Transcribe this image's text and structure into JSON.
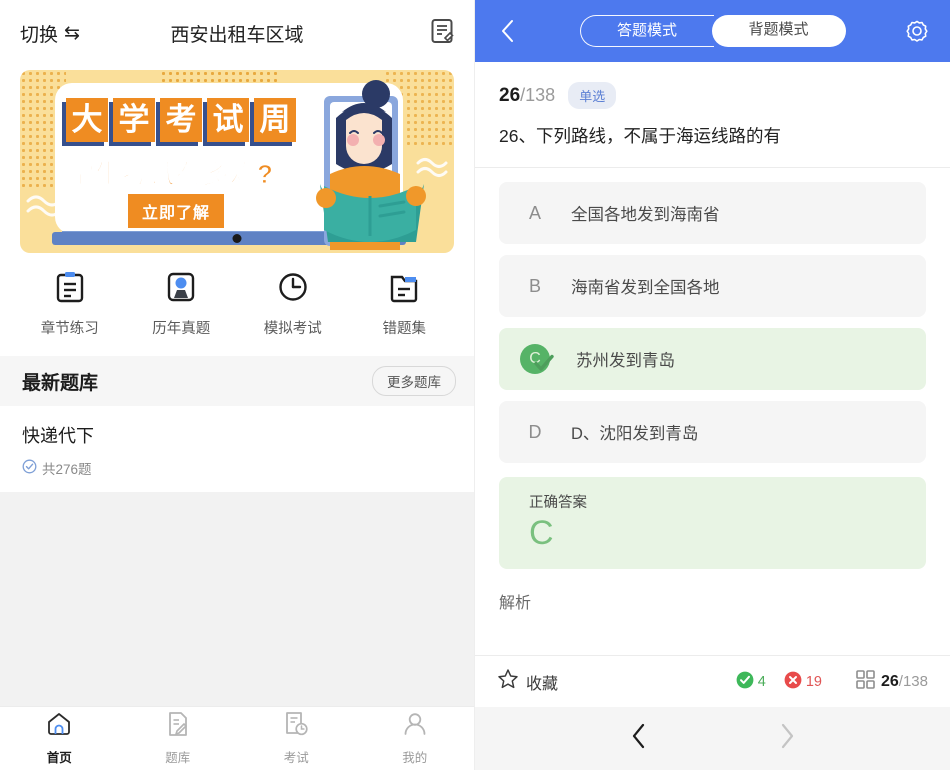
{
  "left": {
    "topbar": {
      "switch_label": "切换",
      "switch_icon": "swap-arrows-icon",
      "title": "西安出租车区域",
      "doc_icon": "note-document-icon"
    },
    "banner": {
      "title_chars": [
        "大",
        "学",
        "考",
        "试",
        "周"
      ],
      "subtitle": "学生考试有多难?",
      "cta_label": "立即了解"
    },
    "quick_actions": [
      {
        "label": "章节练习",
        "icon": "clipboard-icon"
      },
      {
        "label": "历年真题",
        "icon": "award-badge-icon"
      },
      {
        "label": "模拟考试",
        "icon": "clock-icon"
      },
      {
        "label": "错题集",
        "icon": "folder-document-icon"
      }
    ],
    "section": {
      "title": "最新题库",
      "more_label": "更多题库"
    },
    "bank_item": {
      "name": "快递代下",
      "meta": "共276题",
      "meta_icon": "check-circle-icon"
    },
    "tabbar": [
      {
        "label": "首页",
        "icon": "home-icon",
        "active": true
      },
      {
        "label": "题库",
        "icon": "question-bank-icon",
        "active": false
      },
      {
        "label": "考试",
        "icon": "exam-clock-icon",
        "active": false
      },
      {
        "label": "我的",
        "icon": "person-icon",
        "active": false
      }
    ]
  },
  "right": {
    "header": {
      "back_icon": "chevron-left-icon",
      "mode_answer": "答题模式",
      "mode_review": "背题模式",
      "gear_icon": "gear-icon",
      "accent_color": "#4d79ee"
    },
    "question": {
      "current": "26",
      "separator": "/",
      "total": "138",
      "type_badge": "单选",
      "text": "26、下列路线，不属于海运线路的有"
    },
    "options": [
      {
        "letter": "A",
        "text": "全国各地发到海南省",
        "correct": false
      },
      {
        "letter": "B",
        "text": "海南省发到全国各地",
        "correct": false
      },
      {
        "letter": "C",
        "text": "苏州发到青岛",
        "correct": true
      },
      {
        "letter": "D",
        "text": "D、沈阳发到青岛",
        "correct": false
      }
    ],
    "answer": {
      "label": "正确答案",
      "value": "C",
      "color": "#7ac07f"
    },
    "analysis_label": "解析",
    "bottombar": {
      "fav_label": "收藏",
      "fav_icon": "star-outline-icon",
      "correct_count": "4",
      "correct_icon": "check-circle-filled-icon",
      "wrong_count": "19",
      "wrong_icon": "x-circle-filled-icon",
      "grid_icon": "answer-card-grid-icon",
      "progress_current": "26",
      "progress_sep": "/",
      "progress_total": "138"
    },
    "navbar": {
      "prev_icon": "chevron-left-icon",
      "next_icon": "chevron-right-icon"
    }
  }
}
